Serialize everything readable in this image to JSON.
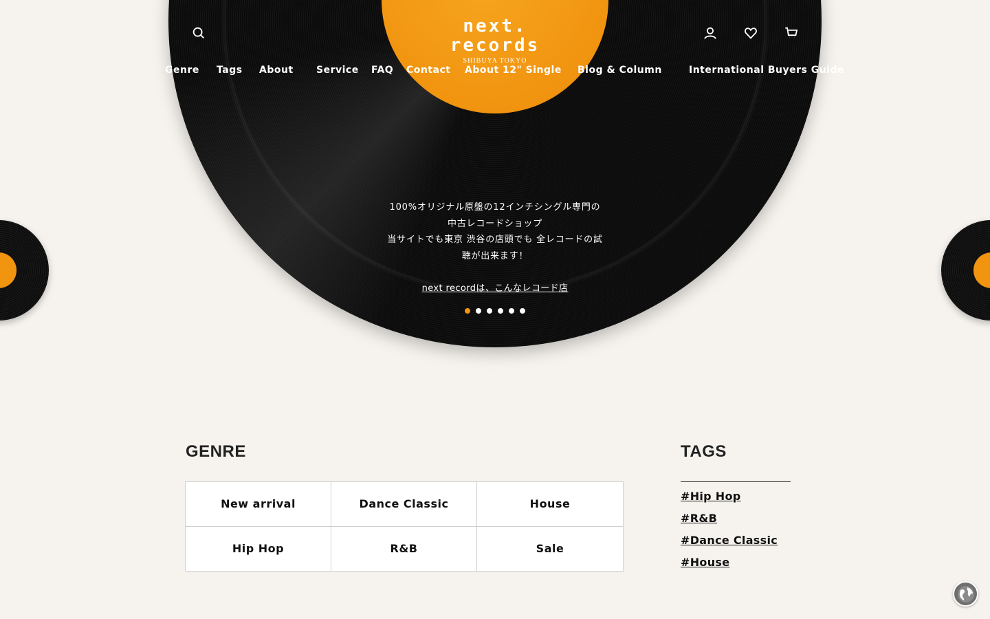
{
  "logo": {
    "text": "next. records",
    "subtitle": "SHIBUYA TOKYO"
  },
  "header": {
    "icons": {
      "search": "search-icon",
      "user": "user-icon",
      "favorites": "heart-icon",
      "cart": "cart-icon"
    }
  },
  "nav": {
    "items": [
      {
        "label": "Genre"
      },
      {
        "label": "Tags"
      },
      {
        "label": "About"
      },
      {
        "label": "Service"
      },
      {
        "label": "FAQ"
      },
      {
        "label": "Contact"
      },
      {
        "label": "About 12\" Single"
      },
      {
        "label": "Blog & Column"
      },
      {
        "label": "International Buyers Guide"
      }
    ]
  },
  "hero": {
    "lines": [
      "100%オリジナル原盤の12インチシングル専門の",
      "中古レコードショップ",
      "当サイトでも東京 渋谷の店頭でも 全レコードの試",
      "聴が出来ます！"
    ],
    "link": "next recordは、こんなレコード店",
    "slide_count": 6,
    "active_slide": 1
  },
  "genre": {
    "title": "GENRE",
    "items": [
      "New arrival",
      "Dance Classic",
      "House",
      "Hip Hop",
      "R&B",
      "Sale"
    ]
  },
  "tags": {
    "title": "TAGS",
    "items": [
      "#Hip Hop",
      "#R&B",
      "#Dance Classic",
      "#House"
    ]
  },
  "colors": {
    "accent": "#f19410",
    "background": "#f6f3ee",
    "vinyl": "#0c0c0c"
  }
}
